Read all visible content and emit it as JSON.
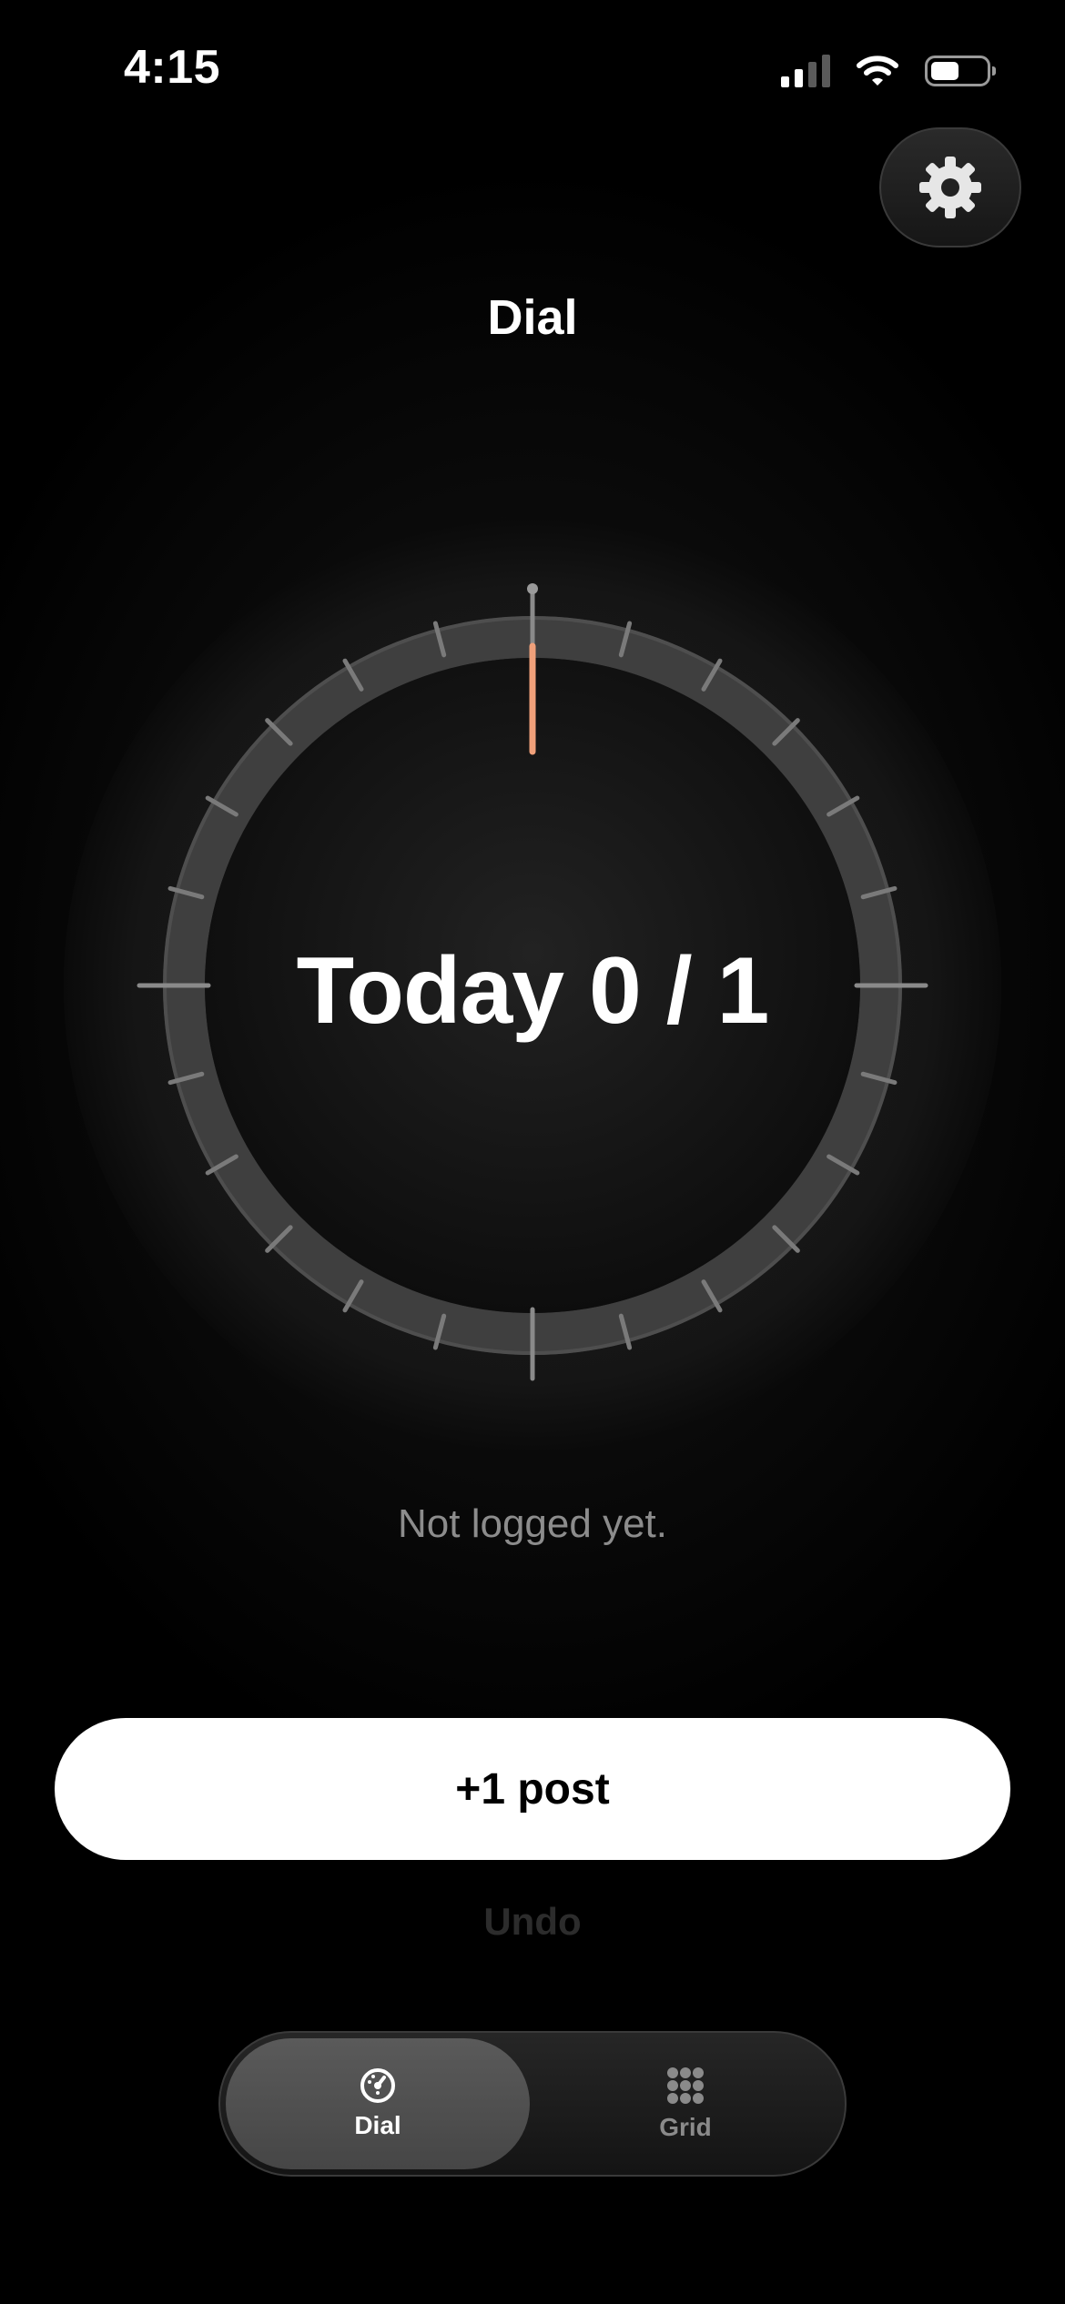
{
  "status_bar": {
    "time": "4:15",
    "icons": [
      "cellular-signal-icon",
      "wifi-icon",
      "battery-icon"
    ]
  },
  "settings": {
    "icon": "gear-icon"
  },
  "header": {
    "title": "Dial"
  },
  "dial": {
    "label": "Today 0 / 1",
    "logged": 0,
    "goal": 1,
    "accent_color": "#F0A07A"
  },
  "status_message": "Not logged yet.",
  "actions": {
    "post_label": "+1 post",
    "undo_label": "Undo"
  },
  "tab_bar": {
    "tabs": [
      {
        "label": "Dial",
        "icon": "dial-icon",
        "selected": true
      },
      {
        "label": "Grid",
        "icon": "grid-icon",
        "selected": false
      }
    ]
  }
}
